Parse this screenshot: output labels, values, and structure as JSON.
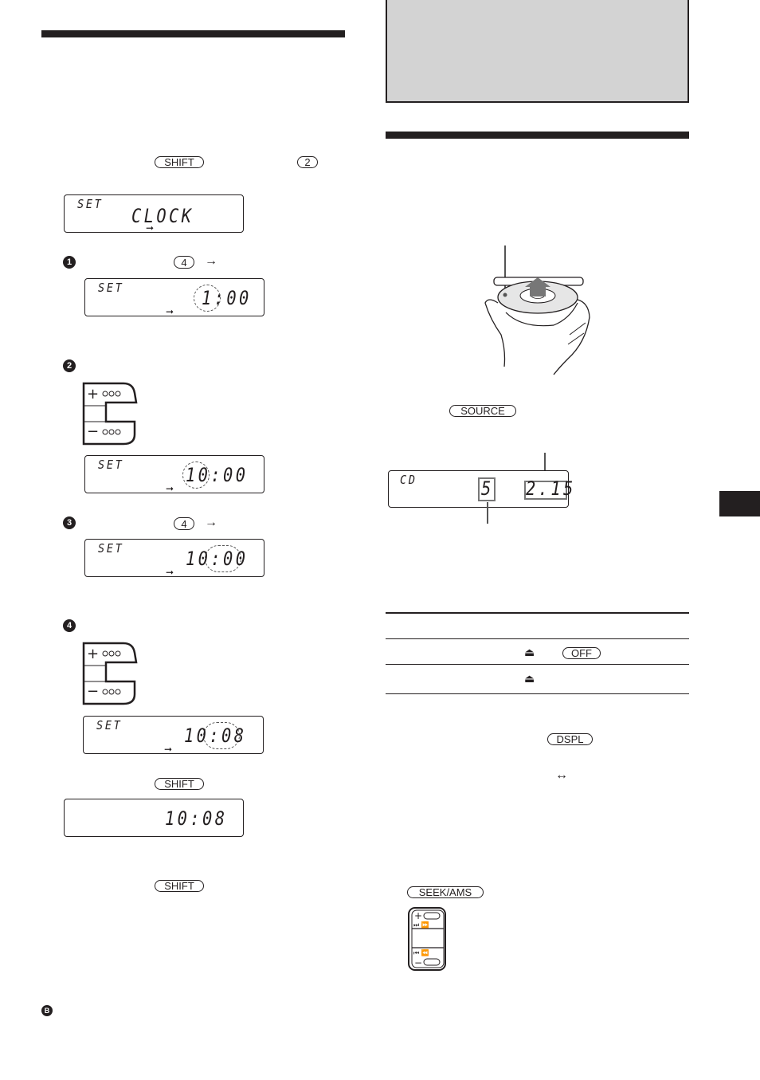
{
  "left_column": {
    "intro_buttons": {
      "shift": "SHIFT",
      "preset_2": "2"
    },
    "display_set_clock": {
      "small": "SET",
      "big": "CLOCK"
    },
    "step1": {
      "number": "1",
      "button": "4",
      "arrow": "→",
      "display": {
        "small": "SET",
        "big": "1:00"
      }
    },
    "step2": {
      "number": "2",
      "rocker": {
        "plus": "+",
        "minus": "−"
      },
      "display": {
        "small": "SET",
        "big": "10:00"
      }
    },
    "step3": {
      "number": "3",
      "button": "4",
      "arrow": "→",
      "display": {
        "small": "SET",
        "big": "10:00"
      }
    },
    "step4": {
      "number": "4",
      "rocker": {
        "plus": "+",
        "minus": "−"
      },
      "display": {
        "small": "SET",
        "big": "10:08"
      }
    },
    "confirm": {
      "shift": "SHIFT",
      "display": {
        "big": "10:08"
      }
    },
    "cancel": {
      "shift": "SHIFT"
    },
    "footer_marker": "B"
  },
  "right_column": {
    "source_button": "SOURCE",
    "cd_display": {
      "source": "CD",
      "track": "5",
      "time": "2.15"
    },
    "table": {
      "rows": [
        {
          "icons": [
            "eject"
          ],
          "button": "OFF"
        },
        {
          "icons": [
            "eject"
          ],
          "button": ""
        }
      ]
    },
    "dspl_button": "DSPL",
    "toggle_arrow": "↔",
    "seek_button": "SEEK/AMS",
    "seek_rocker": {
      "plus": "+",
      "minus": "−",
      "next": "⏭ ⏩",
      "prev": "⏮ ⏪"
    }
  }
}
